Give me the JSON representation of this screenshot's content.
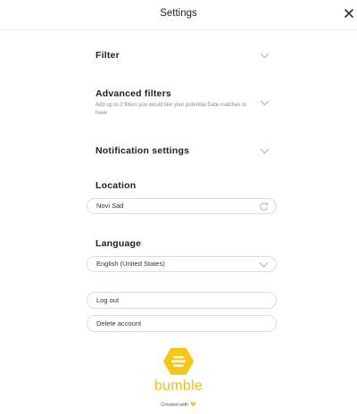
{
  "header": {
    "title": "Settings"
  },
  "sections": {
    "filter": {
      "title": "Filter"
    },
    "advanced": {
      "title": "Advanced filters",
      "subtitle": "Add up to 2 filters you would like your potential Date matches to have"
    },
    "notifications": {
      "title": "Notification settings"
    },
    "location": {
      "title": "Location",
      "value": "Novi Sad"
    },
    "language": {
      "title": "Language",
      "value": "English (United States)"
    }
  },
  "actions": {
    "logout": "Log out",
    "delete": "Delete account"
  },
  "footer": {
    "brand": "bumble",
    "credit": "Created with",
    "brand_color": "#f0c016"
  },
  "icons": {
    "close": "close-icon",
    "chevron": "chevron-down-icon",
    "refresh": "refresh-icon",
    "logo": "bumble-logo",
    "heart": "heart-icon"
  }
}
